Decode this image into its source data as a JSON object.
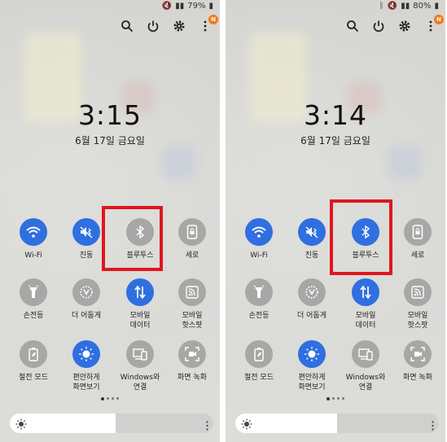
{
  "panels": [
    {
      "status": {
        "battery": "79%"
      },
      "badge": "N",
      "clock": "3:15",
      "date": "6월 17일 금요일",
      "tiles": [
        {
          "label": "Wi-Fi",
          "state": "on",
          "icon": "wifi-icon"
        },
        {
          "label": "진동",
          "state": "on",
          "icon": "vibrate-icon"
        },
        {
          "label": "블루투스",
          "state": "off",
          "icon": "bluetooth-icon"
        },
        {
          "label": "세로",
          "state": "off",
          "icon": "portrait-lock-icon"
        },
        {
          "label": "손전등",
          "state": "off",
          "icon": "flashlight-icon"
        },
        {
          "label": "더 어둡게",
          "state": "off",
          "icon": "extra-dim-icon"
        },
        {
          "label": "모바일\n데이터",
          "state": "on",
          "icon": "mobile-data-icon"
        },
        {
          "label": "모바일\n핫스팟",
          "state": "off",
          "icon": "hotspot-icon"
        },
        {
          "label": "절전 모드",
          "state": "off",
          "icon": "battery-saver-icon"
        },
        {
          "label": "편안하게\n화면보기",
          "state": "on",
          "icon": "eye-comfort-icon"
        },
        {
          "label": "Windows와\n연결",
          "state": "off",
          "icon": "link-windows-icon"
        },
        {
          "label": "화면 녹화",
          "state": "off",
          "icon": "screen-record-icon"
        }
      ],
      "brightness": 0.52,
      "highlight": "bluetooth"
    },
    {
      "status": {
        "battery": "80%"
      },
      "badge": "N",
      "clock": "3:14",
      "date": "6월 17일 금요일",
      "tiles": [
        {
          "label": "Wi-Fi",
          "state": "on",
          "icon": "wifi-icon"
        },
        {
          "label": "진동",
          "state": "on",
          "icon": "vibrate-icon"
        },
        {
          "label": "블루투스",
          "state": "on",
          "icon": "bluetooth-icon"
        },
        {
          "label": "세로",
          "state": "off",
          "icon": "portrait-lock-icon"
        },
        {
          "label": "손전등",
          "state": "off",
          "icon": "flashlight-icon"
        },
        {
          "label": "더 어둡게",
          "state": "off",
          "icon": "extra-dim-icon"
        },
        {
          "label": "모바일\n데이터",
          "state": "on",
          "icon": "mobile-data-icon"
        },
        {
          "label": "모바일\n핫스팟",
          "state": "off",
          "icon": "hotspot-icon"
        },
        {
          "label": "절전 모드",
          "state": "off",
          "icon": "battery-saver-icon"
        },
        {
          "label": "편안하게\n화면보기",
          "state": "on",
          "icon": "eye-comfort-icon"
        },
        {
          "label": "Windows와\n연결",
          "state": "off",
          "icon": "link-windows-icon"
        },
        {
          "label": "화면 녹화",
          "state": "off",
          "icon": "screen-record-icon"
        }
      ],
      "brightness": 0.5,
      "highlight": "bluetooth"
    }
  ],
  "colors": {
    "accent": "#2f6fe0",
    "off": "#a7a7a5",
    "highlight": "#e0161e",
    "badge": "#f07a1a"
  }
}
